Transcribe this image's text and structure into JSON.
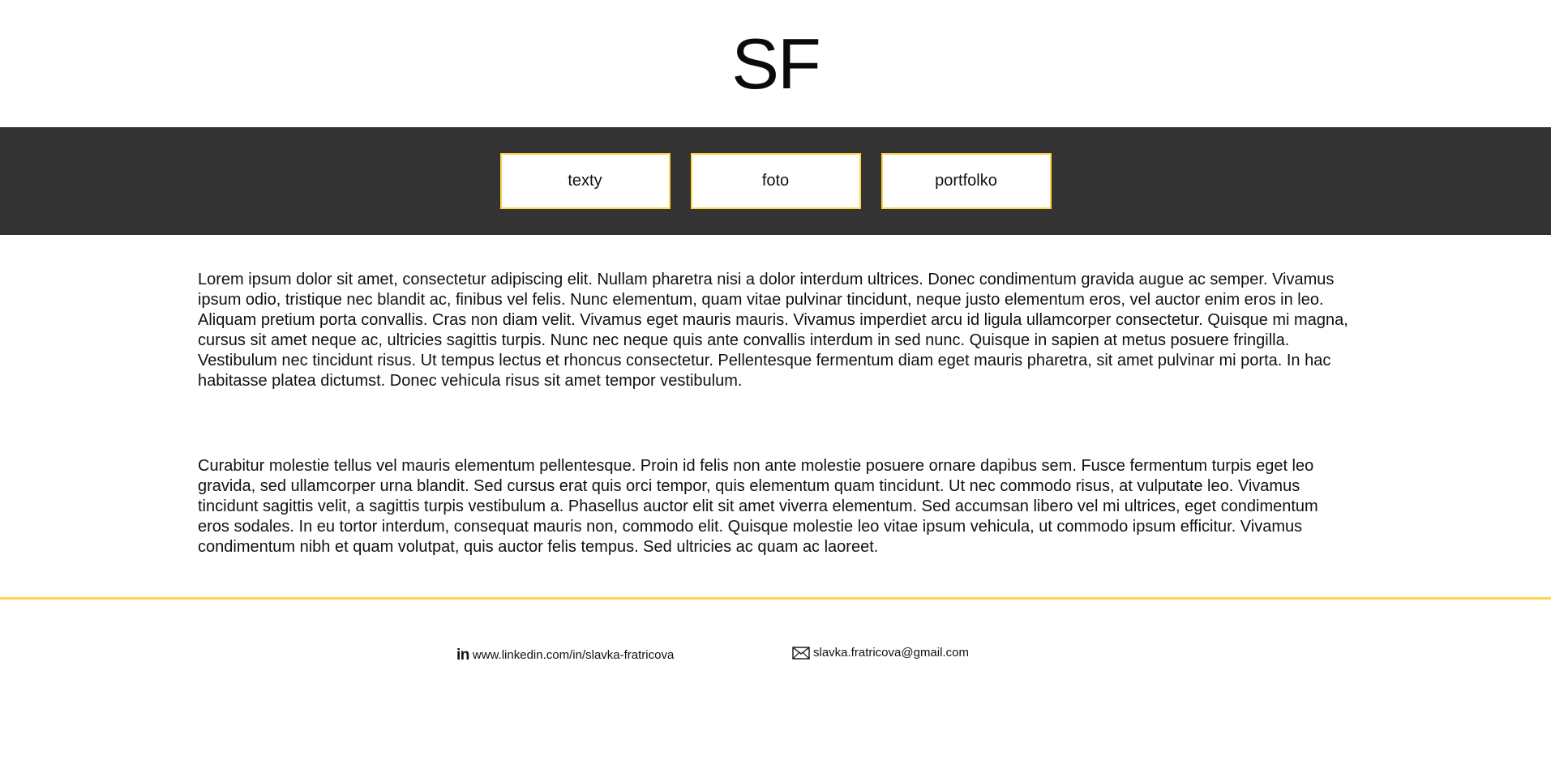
{
  "header": {
    "logo_text": "SF"
  },
  "nav": {
    "items": [
      {
        "label": "texty"
      },
      {
        "label": "foto"
      },
      {
        "label": "portfolko"
      }
    ]
  },
  "main": {
    "paragraphs": [
      "Lorem ipsum dolor sit amet, consectetur adipiscing elit. Nullam pharetra nisi a dolor interdum ultrices. Donec condimentum gravida augue ac semper. Vivamus ipsum odio, tristique nec blandit ac, finibus vel felis. Nunc elementum, quam vitae pulvinar tincidunt, neque justo elementum eros, vel auctor enim eros in leo. Aliquam pretium porta convallis. Cras non diam velit. Vivamus eget mauris mauris. Vivamus imperdiet arcu id ligula ullamcorper consectetur. Quisque mi magna, cursus sit amet neque ac, ultricies sagittis turpis. Nunc nec neque quis ante convallis interdum in sed nunc. Quisque in sapien at metus posuere fringilla. Vestibulum nec tincidunt risus. Ut tempus lectus et rhoncus consectetur. Pellentesque fermentum diam eget mauris pharetra, sit amet pulvinar mi porta. In hac habitasse platea dictumst. Donec vehicula risus sit amet tempor vestibulum.",
      "Curabitur molestie tellus vel mauris elementum pellentesque. Proin id felis non ante molestie posuere ornare dapibus sem. Fusce fermentum turpis eget leo gravida, sed ullamcorper urna blandit. Sed cursus erat quis orci tempor, quis elementum quam tincidunt. Ut nec commodo risus, at vulputate leo. Vivamus tincidunt sagittis velit, a sagittis turpis vestibulum a. Phasellus auctor elit sit amet viverra elementum. Sed accumsan libero vel mi ultrices, eget condimentum eros sodales. In eu tortor interdum, consequat mauris non, commodo elit. Quisque molestie leo vitae ipsum vehicula, ut commodo ipsum efficitur. Vivamus condimentum nibh et quam volutpat, quis auctor felis tempus. Sed ultricies ac quam ac laoreet."
    ]
  },
  "footer": {
    "linkedin": {
      "icon": "linkedin-icon",
      "icon_text": "in",
      "text": "www.linkedin.com/in/slavka-fratricova"
    },
    "email": {
      "icon": "envelope-icon",
      "text": "slavka.fratricova@gmail.com"
    }
  },
  "colors": {
    "nav_background": "#333333",
    "accent": "#ffd54a",
    "text": "#111111",
    "background": "#ffffff"
  }
}
